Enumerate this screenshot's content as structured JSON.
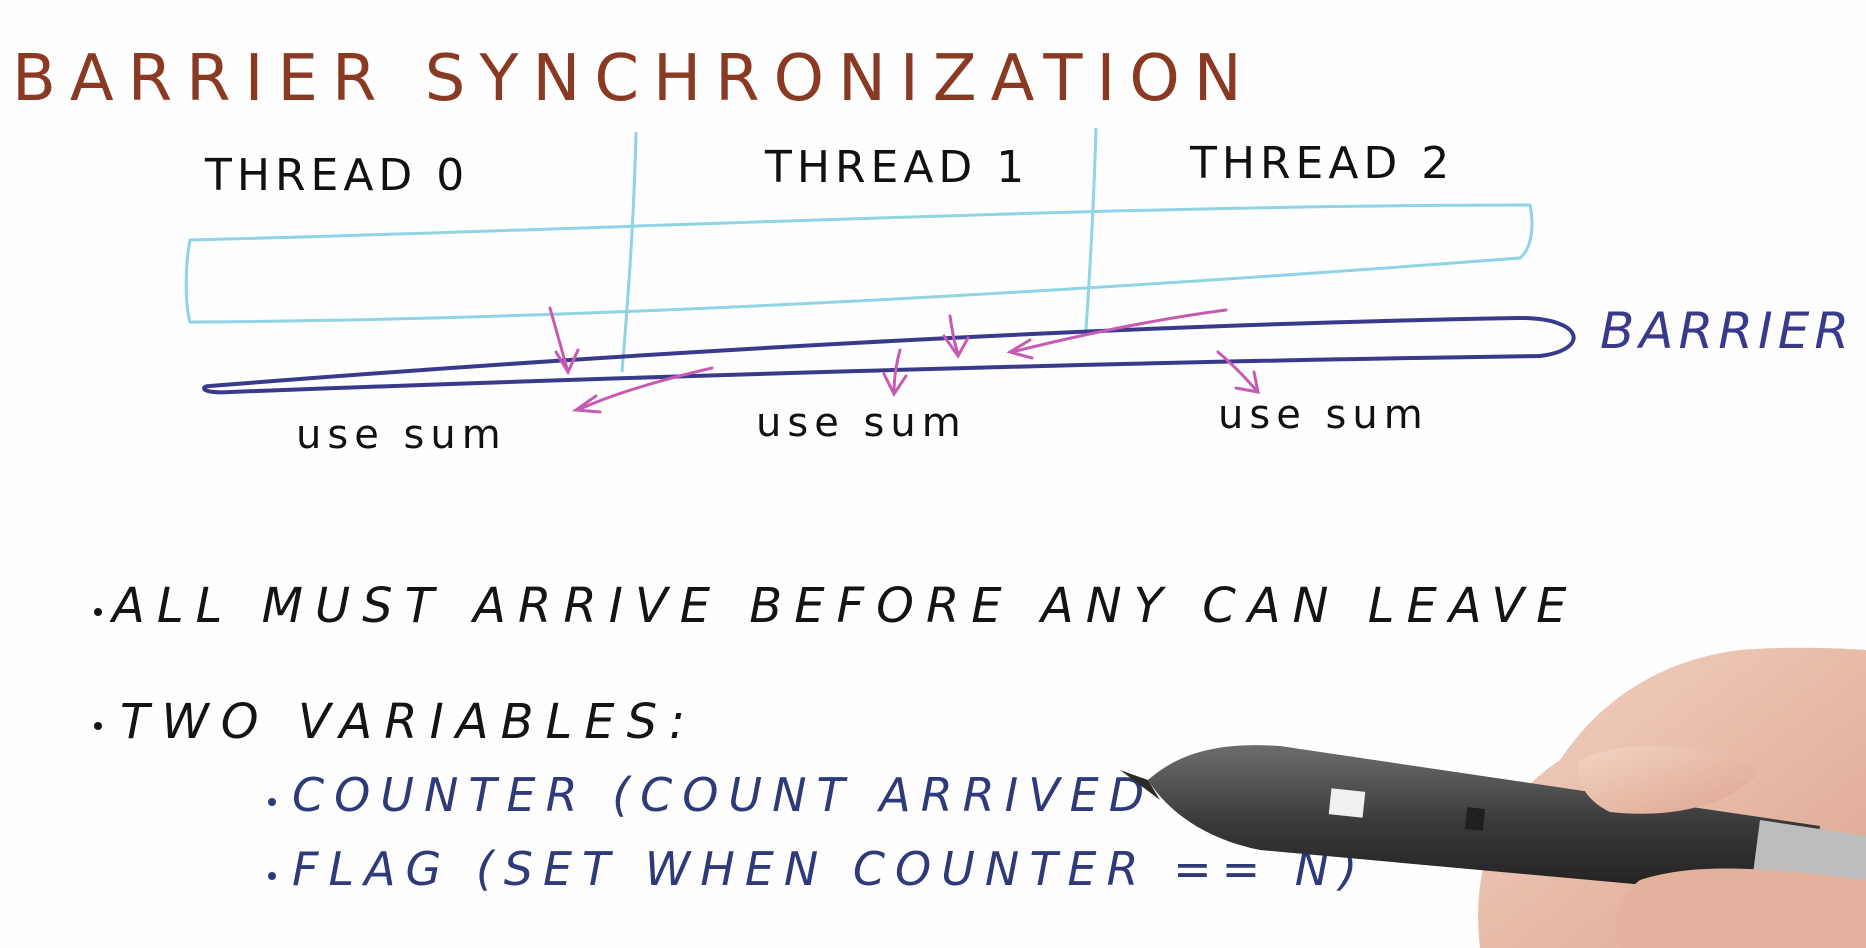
{
  "title": "BARRIER SYNCHRONIZATION",
  "threads": [
    {
      "label": "THREAD 0",
      "action": "use sum"
    },
    {
      "label": "THREAD 1",
      "action": "use sum"
    },
    {
      "label": "THREAD 2",
      "action": "use sum"
    }
  ],
  "barrier_label": "BARRIER",
  "bullets": [
    {
      "text": "ALL MUST ARRIVE BEFORE ANY CAN LEAVE"
    },
    {
      "text": "TWO VARIABLES:"
    }
  ],
  "sub_bullets": [
    {
      "text": "COUNTER (COUNT ARRIVED THREADS)"
    },
    {
      "text": "FLAG (SET WHEN COUNTER == N)"
    }
  ],
  "colors": {
    "title": "#8a3a22",
    "thread_label": "#111111",
    "grid_lines": "#8fd3e6",
    "barrier": "#3a3a8c",
    "arrows": "#c75bb3",
    "bullets": "#141414",
    "sub_bullets": "#2e3a7a"
  }
}
